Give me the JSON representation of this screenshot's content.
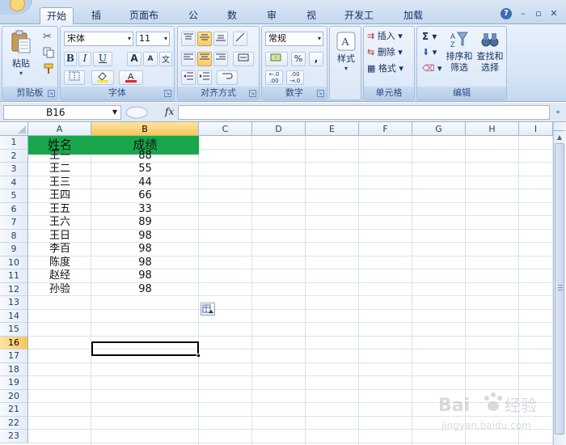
{
  "tabs": [
    "开始",
    "插入",
    "页面布局",
    "公式",
    "数据",
    "审阅",
    "视图",
    "开发工具",
    "加载项"
  ],
  "active_tab": "开始",
  "ribbon": {
    "clipboard": {
      "label": "剪贴板",
      "paste": "粘贴"
    },
    "font": {
      "label": "字体",
      "name": "宋体",
      "size": "11",
      "bold": "B",
      "italic": "I",
      "underline": "U",
      "grow": "A",
      "shrink": "A",
      "wen": "文"
    },
    "alignment": {
      "label": "对齐方式"
    },
    "number": {
      "label": "数字",
      "format": "常规",
      "percent": "%",
      "comma": ","
    },
    "styles": {
      "label": "样式"
    },
    "cells": {
      "label": "单元格",
      "insert": "插入",
      "delete": "删除",
      "format": "格式"
    },
    "editing": {
      "label": "编辑",
      "sum": "Σ",
      "sort_filter": "排序和",
      "sort_filter2": "筛选",
      "find_select": "查找和",
      "find_select2": "选择"
    }
  },
  "formula_bar": {
    "name_box": "B16",
    "fx": "fx",
    "formula": ""
  },
  "columns": [
    "A",
    "B",
    "C",
    "D",
    "E",
    "F",
    "G",
    "H",
    "I"
  ],
  "rows": [
    "1",
    "2",
    "3",
    "4",
    "5",
    "6",
    "7",
    "8",
    "9",
    "10",
    "11",
    "12",
    "13",
    "14",
    "15",
    "16",
    "17",
    "18",
    "19",
    "20",
    "21",
    "22",
    "23"
  ],
  "selected_cell": {
    "column": "B",
    "row": "16"
  },
  "table": {
    "header": [
      "姓名",
      "成绩"
    ],
    "header_color": "#1aa64d",
    "data": [
      [
        "王一",
        "88"
      ],
      [
        "王二",
        "55"
      ],
      [
        "王三",
        "44"
      ],
      [
        "王四",
        "66"
      ],
      [
        "王五",
        "33"
      ],
      [
        "王六",
        "89"
      ],
      [
        "王日",
        "98"
      ],
      [
        "李百",
        "98"
      ],
      [
        "陈度",
        "98"
      ],
      [
        "赵经",
        "98"
      ],
      [
        "孙验",
        "98"
      ]
    ]
  },
  "watermark": {
    "brand": "Bai",
    "suffix": "经验",
    "url": "jingyan.baidu.com"
  }
}
